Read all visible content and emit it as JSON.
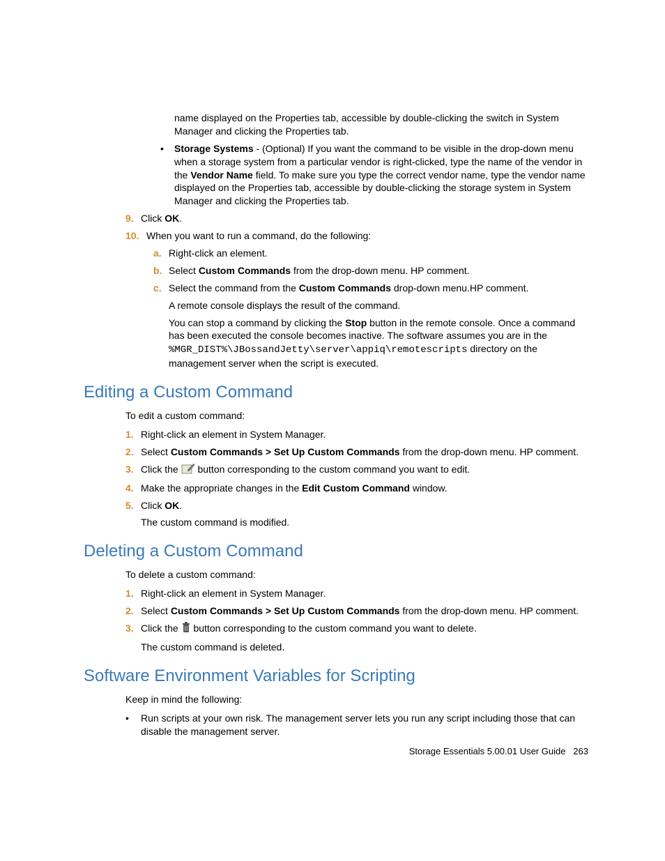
{
  "top": {
    "cont_a": "name displayed on the Properties tab, accessible by double-clicking the switch in System Manager and clicking the Properties tab.",
    "storage_bold": "Storage Systems",
    "storage_text_a": " - (Optional) If you want the command to be visible in the drop-down menu when a storage system from a particular vendor is right-clicked, type the name of the vendor in the ",
    "vendor_bold": "Vendor Name",
    "storage_text_b": " field. To make sure you type the correct vendor name, type the vendor name displayed on the Properties tab, accessible by double-clicking the storage system in System Manager and clicking the Properties tab.",
    "step9_num": "9.",
    "step9_a": "Click ",
    "step9_ok": "OK",
    "step9_b": ".",
    "step10_num": "10.",
    "step10_text": "When you want to run a command, do the following:",
    "sub_a_num": "a.",
    "sub_a": "Right-click an element.",
    "sub_b_num": "b.",
    "sub_b_a": "Select ",
    "sub_b_bold": "Custom Commands",
    "sub_b_b": " from the drop-down menu. HP comment.",
    "sub_c_num": "c.",
    "sub_c_a": "Select the command from the ",
    "sub_c_bold": "Custom Commands",
    "sub_c_b": " drop-down menu.HP comment.",
    "sub_c_after": "A remote console displays the result of the command.",
    "sub_c_stop_a": "You can stop a command by clicking the ",
    "sub_c_stop_bold": "Stop",
    "sub_c_stop_b": " button in the remote console. Once a command has been executed the console becomes inactive. The software assumes you are in the ",
    "sub_c_mono": "%MGR_DIST%\\JBossandJetty\\server\\appiq\\remotescripts",
    "sub_c_stop_c": " directory on the management server when the script is executed."
  },
  "edit": {
    "heading": "Editing a Custom Command",
    "intro": "To edit a custom command:",
    "s1_num": "1.",
    "s1": "Right-click an element in System Manager.",
    "s2_num": "2.",
    "s2_a": "Select ",
    "s2_bold": "Custom Commands > Set Up Custom Commands",
    "s2_b": " from the drop-down menu. HP comment.",
    "s3_num": "3.",
    "s3_a": "Click the ",
    "s3_b": " button corresponding to the custom command you want to edit.",
    "s4_num": "4.",
    "s4_a": "Make the appropriate changes in the ",
    "s4_bold": "Edit Custom Command",
    "s4_b": " window.",
    "s5_num": "5.",
    "s5_a": "Click ",
    "s5_ok": "OK",
    "s5_b": ".",
    "s5_after": "The custom command is modified."
  },
  "del": {
    "heading": "Deleting a Custom Command",
    "intro": "To delete a custom command:",
    "s1_num": "1.",
    "s1": "Right-click an element in System Manager.",
    "s2_num": "2.",
    "s2_a": "Select ",
    "s2_bold": "Custom Commands > Set Up Custom Commands",
    "s2_b": " from the drop-down menu. HP comment.",
    "s3_num": "3.",
    "s3_a": "Click the ",
    "s3_b": " button corresponding to the custom command you want to delete.",
    "s3_after": "The custom command is deleted."
  },
  "env": {
    "heading": "Software Environment Variables for Scripting",
    "intro": "Keep in mind the following:",
    "b1": "Run scripts at your own risk. The management server lets you run any script including those that can disable the management server."
  },
  "footer": {
    "text": "Storage Essentials 5.00.01 User Guide",
    "page": "263"
  }
}
